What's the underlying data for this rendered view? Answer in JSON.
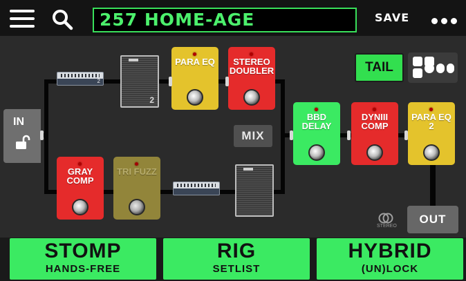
{
  "topbar": {
    "menu_icon": "hamburger-menu-icon",
    "search_icon": "search-icon",
    "preset_name": "257 HOME-AGE",
    "save_label": "SAVE",
    "more_icon": "more-dots-icon"
  },
  "signal_chain": {
    "input_label": "IN",
    "input_icon": "unlock-icon",
    "output_label": "OUT",
    "stereo_icon": "stereo-rings-icon",
    "stereo_label": "STEREO",
    "mix_label": "MIX",
    "tail_label": "TAIL",
    "grid_icon": "block-grid-icon",
    "path_a": {
      "amp_head_number": "2",
      "cab_number": "2",
      "pedals": [
        {
          "label": "PARA EQ",
          "color": "#e4c32c",
          "enabled": true
        },
        {
          "label": "STEREO\nDOUBLER",
          "color": "#e52b2b",
          "enabled": true
        }
      ]
    },
    "path_b": {
      "pedals": [
        {
          "label": "GRAY\nCOMP",
          "color": "#e52b2b",
          "enabled": true
        },
        {
          "label": "TRI FUZZ",
          "color": "#e4c32c",
          "enabled": false
        }
      ]
    },
    "post": {
      "pedals": [
        {
          "label": "BBD\nDELAY",
          "color": "#3bea62",
          "enabled": true
        },
        {
          "label": "DYNIII\nCOMP",
          "color": "#e52b2b",
          "enabled": true
        },
        {
          "label": "PARA EQ\n2",
          "color": "#e4c32c",
          "enabled": true
        }
      ]
    }
  },
  "footer": {
    "buttons": [
      {
        "title": "STOMP",
        "subtitle": "HANDS-FREE"
      },
      {
        "title": "RIG",
        "subtitle": "SETLIST"
      },
      {
        "title": "HYBRID",
        "subtitle": "(UN)LOCK"
      }
    ]
  },
  "colors": {
    "accent_green": "#3bea62",
    "preset_text": "#4cf06c",
    "pedal_yellow": "#e4c32c",
    "pedal_red": "#e52b2b",
    "background": "#2b2b2b"
  }
}
